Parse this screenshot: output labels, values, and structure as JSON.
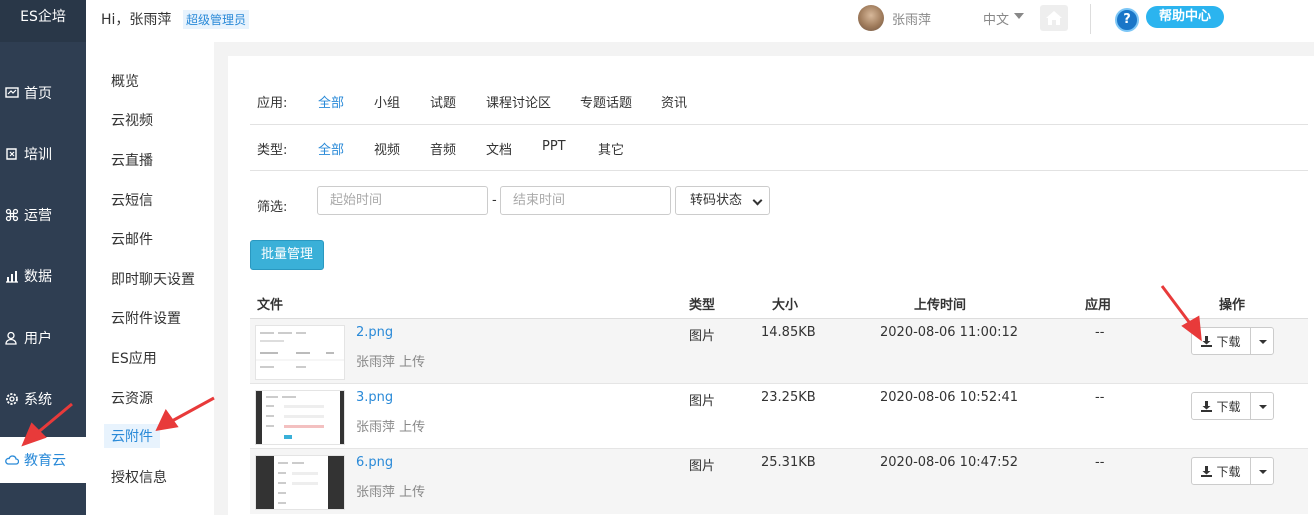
{
  "brand": "ES企培",
  "leftnav": {
    "items": [
      {
        "label": "首页",
        "icon": "dashboard-icon"
      },
      {
        "label": "培训",
        "icon": "book-icon"
      },
      {
        "label": "运营",
        "icon": "command-icon"
      },
      {
        "label": "数据",
        "icon": "chart-icon"
      },
      {
        "label": "用户",
        "icon": "user-icon"
      },
      {
        "label": "系统",
        "icon": "gear-icon"
      },
      {
        "label": "教育云",
        "icon": "cloud-icon"
      }
    ]
  },
  "topbar": {
    "greeting": "Hi，张雨萍",
    "role": "超级管理员",
    "user_name": "张雨萍",
    "language": "中文",
    "help": "帮助中心",
    "help_q": "?"
  },
  "subnav": {
    "items": [
      "概览",
      "云视频",
      "云直播",
      "云短信",
      "云邮件",
      "即时聊天设置",
      "云附件设置",
      "ES应用",
      "云资源",
      "云附件",
      "授权信息"
    ]
  },
  "filters": {
    "app_label": "应用:",
    "app_options": [
      "全部",
      "小组",
      "试题",
      "课程讨论区",
      "专题话题",
      "资讯"
    ],
    "type_label": "类型:",
    "type_options": [
      "全部",
      "视频",
      "音频",
      "文档",
      "PPT",
      "其它"
    ],
    "filter_label": "筛选:",
    "start_placeholder": "起始时间",
    "dash": "-",
    "end_placeholder": "结束时间",
    "transcode": "转码状态"
  },
  "batch_button": "批量管理",
  "table": {
    "headers": [
      "文件",
      "类型",
      "大小",
      "上传时间",
      "应用",
      "操作"
    ],
    "rows": [
      {
        "name": "2.png",
        "uploader": "张雨萍 上传",
        "type": "图片",
        "size": "14.85KB",
        "time": "2020-08-06 11:00:12",
        "app": "--",
        "action": "下载"
      },
      {
        "name": "3.png",
        "uploader": "张雨萍 上传",
        "type": "图片",
        "size": "23.25KB",
        "time": "2020-08-06 10:52:41",
        "app": "--",
        "action": "下载"
      },
      {
        "name": "6.png",
        "uploader": "张雨萍 上传",
        "type": "图片",
        "size": "25.31KB",
        "time": "2020-08-06 10:47:52",
        "app": "--",
        "action": "下载"
      }
    ]
  },
  "colors": {
    "accent": "#2a8ad8",
    "nav_bg": "#2f3e52",
    "annotation_arrow": "#e83a3a"
  }
}
